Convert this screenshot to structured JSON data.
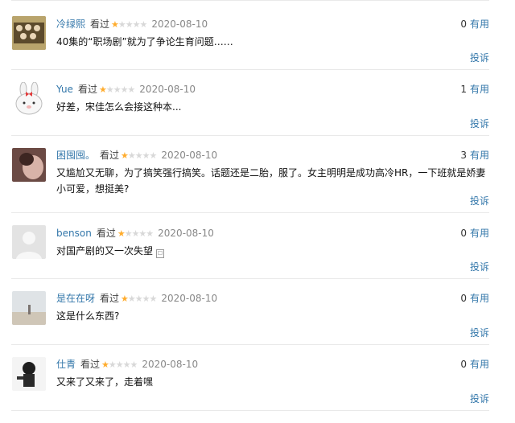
{
  "comments": [
    {
      "user": "冷绿熙",
      "watched": "看过",
      "rating": 1,
      "date": "2020-08-10",
      "votes": "0",
      "useful": "有用",
      "text": "40集的“职场剧”就为了争论生育问题……",
      "report": "投诉"
    },
    {
      "user": "Yue",
      "watched": "看过",
      "rating": 1,
      "date": "2020-08-10",
      "votes": "1",
      "useful": "有用",
      "text": "好差，宋佳怎么会接这种本...",
      "report": "投诉"
    },
    {
      "user": "困囤囤。",
      "watched": "看过",
      "rating": 1,
      "date": "2020-08-10",
      "votes": "3",
      "useful": "有用",
      "text": "又尴尬又无聊，为了搞笑强行搞笑。话题还是二胎，服了。女主明明是成功高冷HR，一下班就是娇妻小可爱，想挺美?",
      "report": "投诉"
    },
    {
      "user": "benson",
      "watched": "看过",
      "rating": 1,
      "date": "2020-08-10",
      "votes": "0",
      "useful": "有用",
      "text": "对国产剧的又一次失望",
      "report": "投诉"
    },
    {
      "user": "是在在呀",
      "watched": "看过",
      "rating": 1,
      "date": "2020-08-10",
      "votes": "0",
      "useful": "有用",
      "text": "这是什么东西?",
      "report": "投诉"
    },
    {
      "user": "仕青",
      "watched": "看过",
      "rating": 1,
      "date": "2020-08-10",
      "votes": "0",
      "useful": "有用",
      "text": "又来了又来了，走着嘿",
      "report": "投诉"
    }
  ],
  "colors": {
    "link": "#3377aa",
    "star": "#ffac2d",
    "star_off": "#d8d8d8"
  }
}
